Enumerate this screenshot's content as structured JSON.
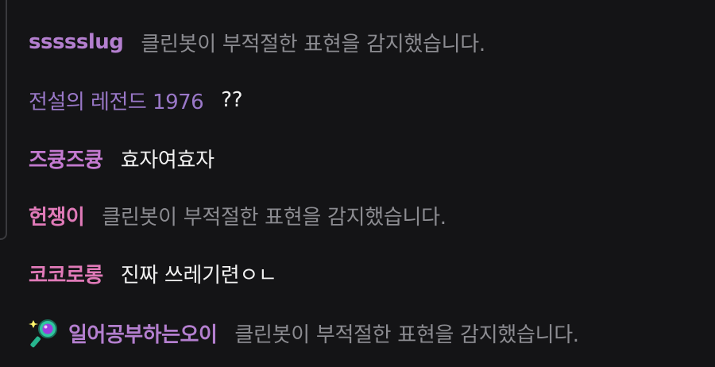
{
  "colors": {
    "background": "#141416",
    "nick_purple": "#b88ad0",
    "nick_pink": "#e07ab8",
    "filtered_text": "#8c8c91",
    "normal_text": "#f2f2f2"
  },
  "messages": [
    {
      "nickname": "ssssslug",
      "nick_color": "#b47fcf",
      "text": "클린봇이 부적절한 표현을 감지했습니다.",
      "filtered": true
    },
    {
      "nickname": "전설의 레전드 1976",
      "nick_color": "#9a78c8",
      "text": "??",
      "filtered": false
    },
    {
      "nickname": "즈큥즈큥",
      "nick_color": "#c47ad0",
      "text": "효자여효자",
      "filtered": false
    },
    {
      "nickname": "헌쟁이",
      "nick_color": "#e07ab8",
      "text": "클린봇이 부적절한 표현을 감지했습니다.",
      "filtered": true
    },
    {
      "nickname": "코코로롱",
      "nick_color": "#e07ab8",
      "text": "진짜 쓰레기련ㅇㄴ",
      "filtered": false
    },
    {
      "nickname": "일어공부하는오이",
      "nick_color": "#b47fcf",
      "text": "클린봇이 부적절한 표현을 감지했습니다.",
      "filtered": true,
      "badge": "magnifier-badge-icon"
    }
  ]
}
